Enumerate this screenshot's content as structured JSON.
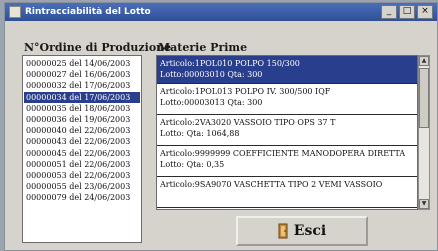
{
  "window": {
    "title": "Rintracciabilità del Lotto",
    "minimize": "_",
    "maximize": "□",
    "close": "×"
  },
  "labels": {
    "orders": "N°Ordine di Produzione",
    "materials": "Materie Prime"
  },
  "orders": [
    "00000025 del 14/06/2003",
    "00000027 del 16/06/2003",
    "00000032 del 17/06/2003",
    "00000034 del 17/06/2003",
    "00000035 del 18/06/2003",
    "00000036 del 19/06/2003",
    "00000040 del 22/06/2003",
    "00000043 del 22/06/2003",
    "00000045 del 22/06/2003",
    "00000051 del 22/06/2003",
    "00000053 del 22/06/2003",
    "00000055 del 23/06/2003",
    "00000079 del 24/06/2003"
  ],
  "selected_order_index": 3,
  "materials": [
    {
      "line1": "Articolo:1POL010 POLPO 150/300",
      "line2": "Lotto:00003010 Qta: 300",
      "selected": true
    },
    {
      "line1": "Articolo:1POL013 POLPO IV. 300/500 IQF",
      "line2": "Lotto:00003013 Qta: 300",
      "selected": false
    },
    {
      "line1": "Articolo:2VA3020 VASSOIO TIPO OPS 37 T",
      "line2": "Lotto: Qta: 1064,88",
      "selected": false
    },
    {
      "line1": "Articolo:9999999 COEFFICIENTE MANODOPERA DIRETTA",
      "line2": "Lotto: Qta: 0,35",
      "selected": false
    },
    {
      "line1": "Articolo:9SA9070 VASCHETTA TIPO 2 VEMI VASSOIO",
      "line2": "",
      "selected": false
    }
  ],
  "exit_button": {
    "label": "Esci",
    "icon": "door-exit-icon"
  },
  "colors": {
    "selection": "#2a3e8e",
    "titlebar": "#2f4f96",
    "window_bg": "#d6d3cc"
  }
}
